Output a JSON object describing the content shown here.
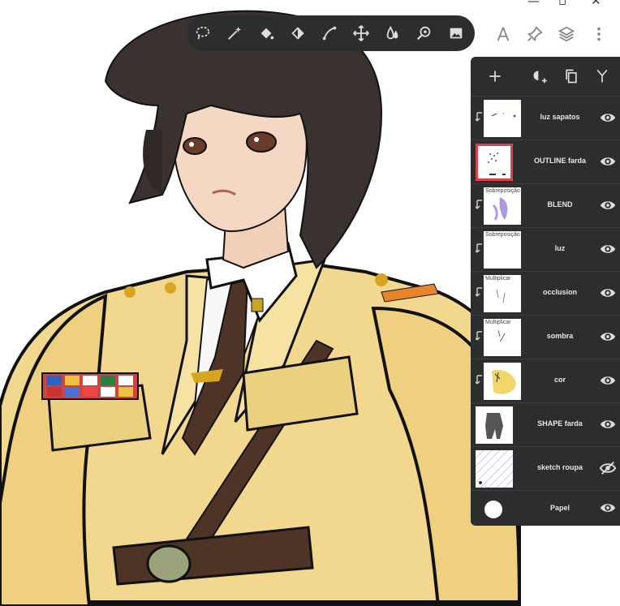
{
  "toolbar": {
    "tools": [
      {
        "name": "lasso-icon"
      },
      {
        "name": "magic-wand-icon"
      },
      {
        "name": "fill-icon"
      },
      {
        "name": "gradient-fill-icon"
      },
      {
        "name": "pen-path-icon"
      },
      {
        "name": "move-icon"
      },
      {
        "name": "liquify-icon"
      },
      {
        "name": "zoom-lens-icon"
      },
      {
        "name": "image-icon"
      }
    ]
  },
  "right_tools": [
    {
      "name": "ruler-icon"
    },
    {
      "name": "pin-icon"
    },
    {
      "name": "layers-icon"
    },
    {
      "name": "more-icon"
    }
  ],
  "layers_panel": {
    "header_icons": [
      "add-layer-icon",
      "add-effect-icon",
      "duplicate-icon",
      "merge-icon"
    ],
    "layers": [
      {
        "name": "luz sapatos",
        "blend": "",
        "clipped": true,
        "visible": true,
        "selected": false
      },
      {
        "name": "OUTLINE farda",
        "blend": "",
        "clipped": false,
        "visible": true,
        "selected": true
      },
      {
        "name": "BLEND",
        "blend": "Sobreposição",
        "clipped": true,
        "visible": true,
        "selected": false
      },
      {
        "name": "luz",
        "blend": "Sobreposição",
        "clipped": true,
        "visible": true,
        "selected": false
      },
      {
        "name": "occlusion",
        "blend": "Multiplicar",
        "clipped": true,
        "visible": true,
        "selected": false
      },
      {
        "name": "sombra",
        "blend": "Multiplicar",
        "clipped": true,
        "visible": true,
        "selected": false
      },
      {
        "name": "cor",
        "blend": "",
        "clipped": true,
        "visible": true,
        "selected": false
      },
      {
        "name": "SHAPE farda",
        "blend": "",
        "clipped": false,
        "visible": true,
        "selected": false
      },
      {
        "name": "sketch roupa",
        "blend": "",
        "clipped": false,
        "visible": false,
        "selected": false
      },
      {
        "name": "Papel",
        "blend": "",
        "clipped": false,
        "visible": true,
        "selected": false
      }
    ]
  },
  "colors": {
    "panel_bg": "#2b2d2e",
    "selection": "#e04048",
    "hair": "#3a3230",
    "uniform": "#f0d58a",
    "tie": "#4e3426"
  }
}
